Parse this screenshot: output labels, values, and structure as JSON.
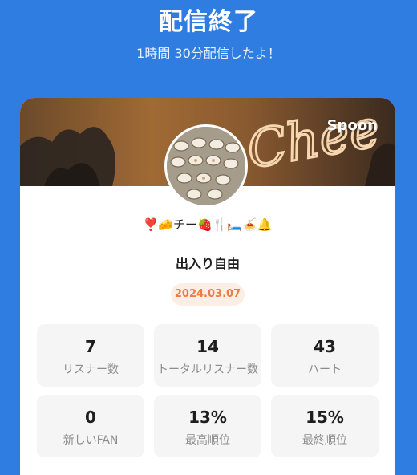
{
  "header": {
    "title": "配信終了",
    "subtitle": "1時間 30分配信したよ！"
  },
  "card": {
    "brand": "Spoon",
    "banner_text": "Chee",
    "emoji_line": "❣️🧀チー🍓🍴🛏️🍝🔔",
    "room_title": "出入り自由",
    "date": "2024.03.07",
    "stats": [
      {
        "value": "7",
        "label": "リスナー数"
      },
      {
        "value": "14",
        "label": "トータルリスナー数"
      },
      {
        "value": "43",
        "label": "ハート"
      },
      {
        "value": "0",
        "label": "新しいFAN"
      },
      {
        "value": "13%",
        "label": "最高順位"
      },
      {
        "value": "15%",
        "label": "最終順位"
      }
    ]
  },
  "colors": {
    "background": "#2f7de1",
    "date_badge_bg": "#fdeee5",
    "date_badge_text": "#ef7a45",
    "stat_bg": "#f5f5f5"
  }
}
